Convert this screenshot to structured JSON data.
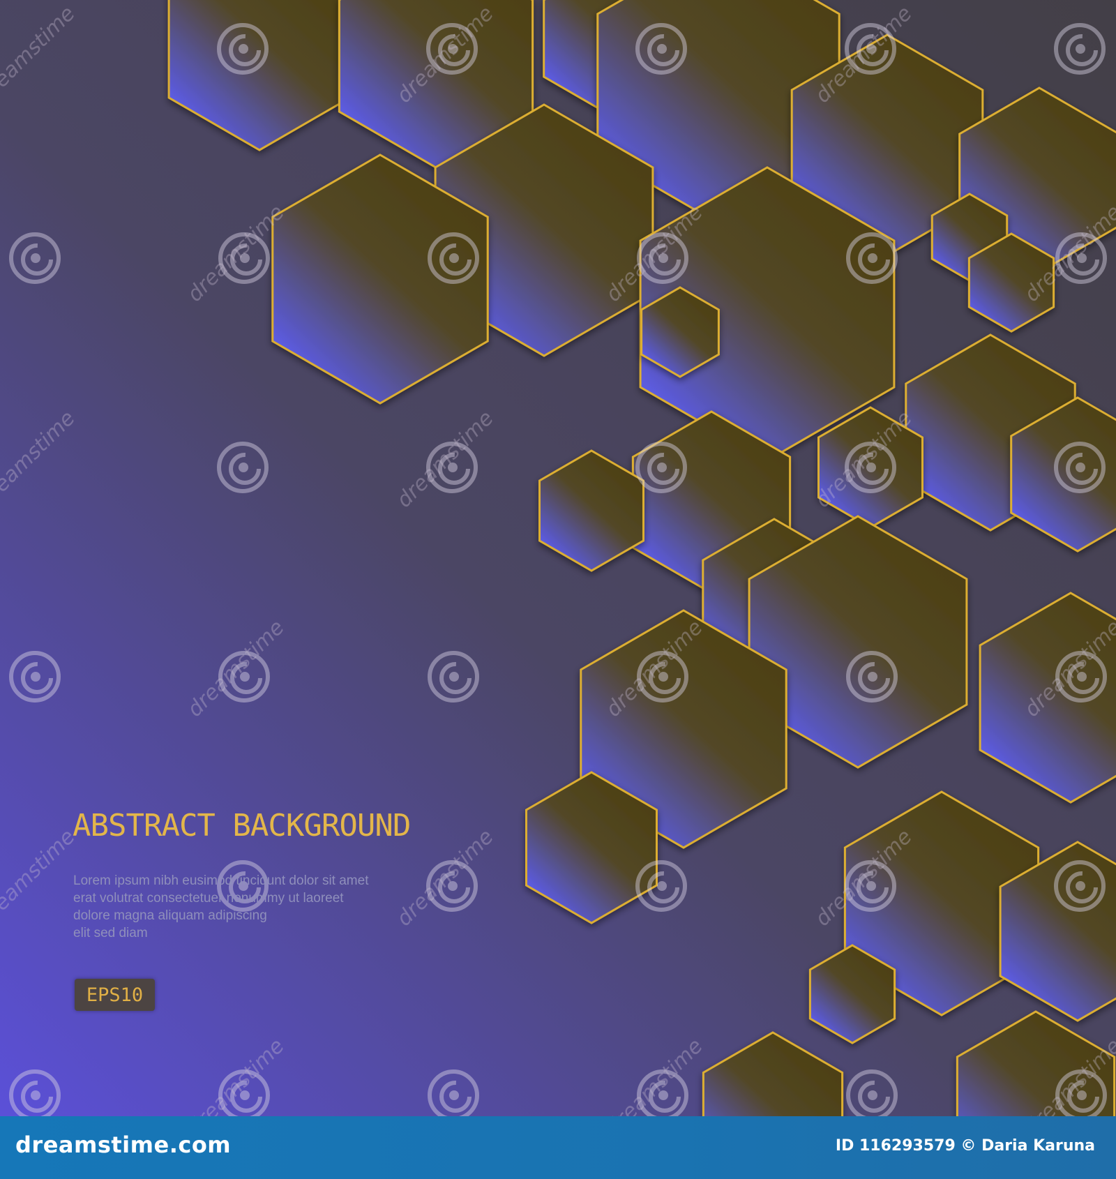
{
  "colors": {
    "background_top": "#47424f",
    "background_bottom_left": "#5a4fd8",
    "hex_fill_dark": "#4d4016",
    "hex_fill_light": "#5a5ad6",
    "hex_outline": "#dcae32",
    "title_color": "#e3b64a"
  },
  "headline": {
    "title": "ABSTRACT BACKGROUND",
    "body_lines": [
      "Lorem ipsum nibh eusimod tincidunt dolor sit amet",
      "erat volutrat consectetuer nonummy ut laoreet",
      "dolore magna aliquam adipiscing",
      "elit sed diam"
    ],
    "badge": "EPS10"
  },
  "watermark": {
    "text": "dreamstime",
    "icon": "spiral-icon"
  },
  "footer": {
    "logo": "dreamstime.com",
    "credit": "ID 116293579 © Daria Karuna"
  }
}
